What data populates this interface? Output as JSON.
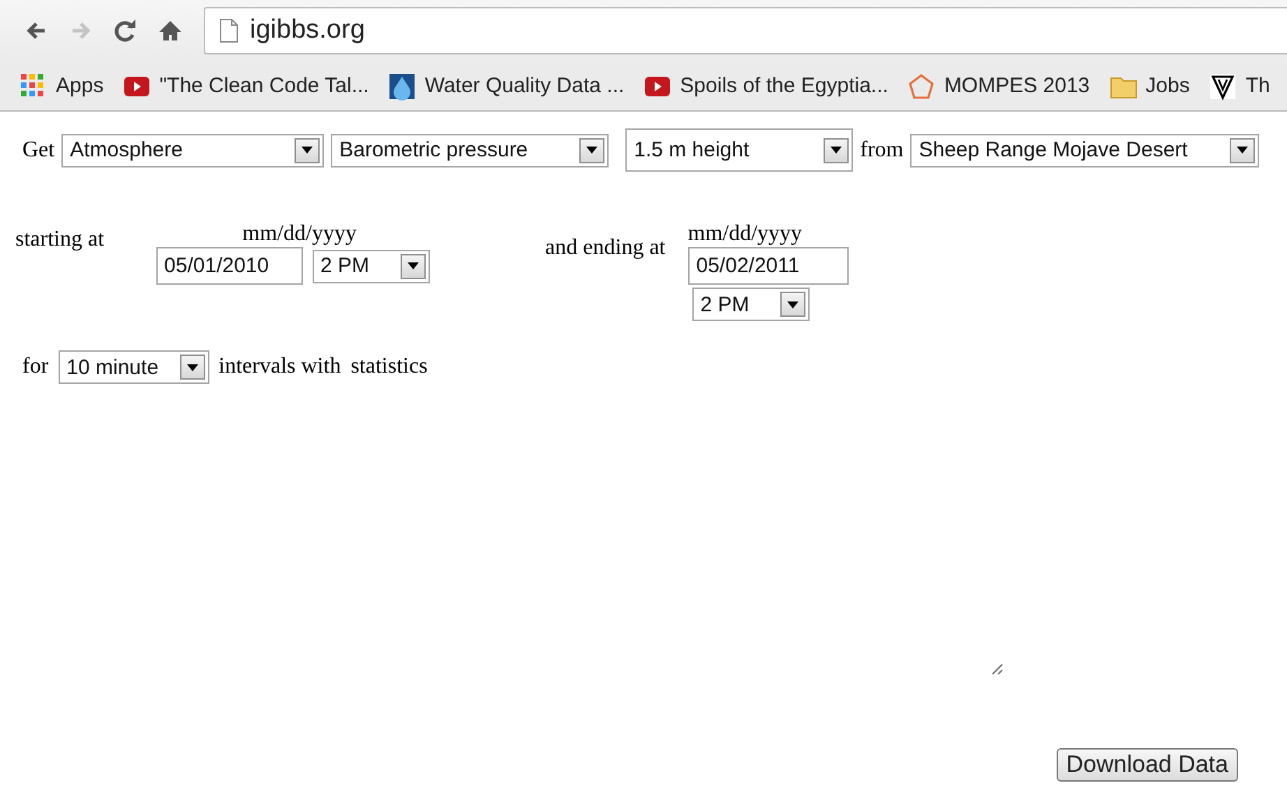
{
  "browser": {
    "nav": [
      {
        "kind": "back",
        "disabled": false
      },
      {
        "kind": "forward",
        "disabled": true
      },
      {
        "kind": "reload",
        "disabled": false
      },
      {
        "kind": "home",
        "disabled": false
      }
    ],
    "address": "igibbs.org"
  },
  "bookmarks": [
    {
      "kind": "apps",
      "label": "Apps"
    },
    {
      "kind": "video",
      "label": "\"The Clean Code Tal..."
    },
    {
      "kind": "drop",
      "label": "Water Quality Data ..."
    },
    {
      "kind": "video",
      "label": "Spoils of the Egyptia..."
    },
    {
      "kind": "pentagon",
      "label": "MOMPES 2013"
    },
    {
      "kind": "folder",
      "label": "Jobs"
    },
    {
      "kind": "shield",
      "label": "Th"
    }
  ],
  "form": {
    "get_label": "Get",
    "selects": [
      "Atmosphere",
      "Barometric pressure",
      "1.5 m height"
    ],
    "from_label": "from",
    "site": "Sheep Range Mojave Desert",
    "start": {
      "label": "starting at",
      "format": "mm/dd/yyyy",
      "date": "05/01/2010",
      "time": "2 PM"
    },
    "end": {
      "label": "and ending at",
      "format": "mm/dd/yyyy",
      "date": "05/02/2011",
      "time": "2 PM"
    },
    "for_label": "for",
    "interval": "10 minute",
    "intervals_label": "intervals with",
    "statistics_label": "statistics"
  },
  "download_button": "Download Data"
}
